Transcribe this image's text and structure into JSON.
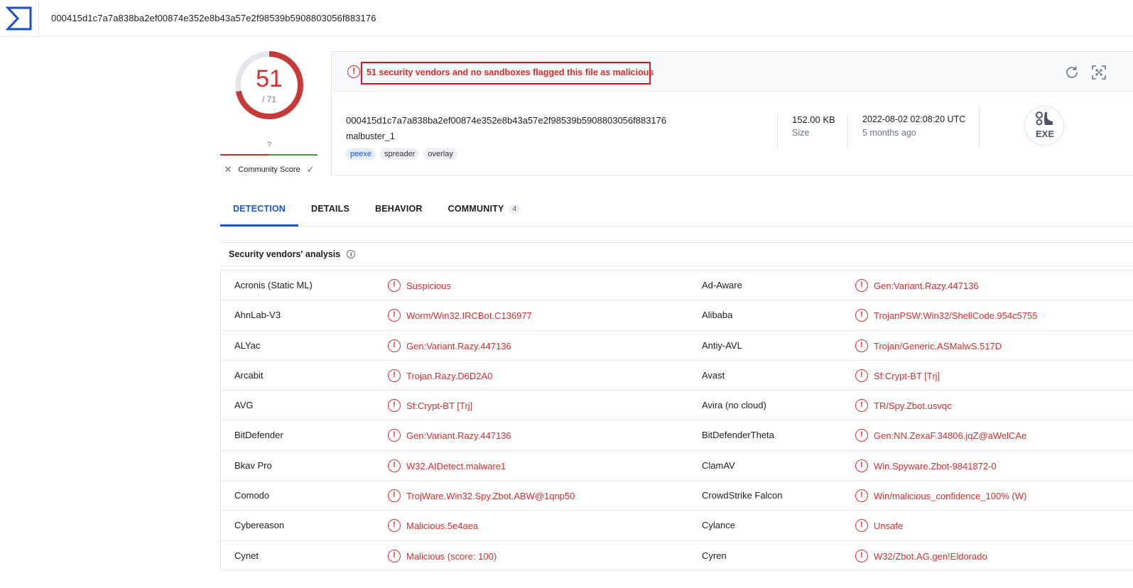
{
  "search": {
    "value": "000415d1c7a7a838ba2ef00874e352e8b43a57e2f98539b5908803056f883176"
  },
  "score": {
    "detections": "51",
    "total": "/ 71",
    "detections_fraction": 0.718
  },
  "community": {
    "score_value": "?",
    "label": "Community Score"
  },
  "alert": {
    "text": "51 security vendors and no sandboxes flagged this file as malicious"
  },
  "file": {
    "hash": "000415d1c7a7a838ba2ef00874e352e8b43a57e2f98539b5908803056f883176",
    "name": "malbuster_1",
    "tags": [
      "peexe",
      "spreader",
      "overlay"
    ],
    "size_value": "152.00 KB",
    "size_label": "Size",
    "date_value": "2022-08-02 02:08:20 UTC",
    "date_label": "5 months ago",
    "type_label": "EXE"
  },
  "tabs": [
    {
      "label": "DETECTION",
      "active": true
    },
    {
      "label": "DETAILS",
      "active": false
    },
    {
      "label": "BEHAVIOR",
      "active": false
    },
    {
      "label": "COMMUNITY",
      "active": false,
      "badge": "4"
    }
  ],
  "section": {
    "title": "Security vendors' analysis"
  },
  "vendors": [
    {
      "left_name": "Acronis (Static ML)",
      "left_result": "Suspicious",
      "right_name": "Ad-Aware",
      "right_result": "Gen:Variant.Razy.447136"
    },
    {
      "left_name": "AhnLab-V3",
      "left_result": "Worm/Win32.IRCBot.C136977",
      "right_name": "Alibaba",
      "right_result": "TrojanPSW:Win32/ShellCode.954c5755"
    },
    {
      "left_name": "ALYac",
      "left_result": "Gen:Variant.Razy.447136",
      "right_name": "Antiy-AVL",
      "right_result": "Trojan/Generic.ASMalwS.517D"
    },
    {
      "left_name": "Arcabit",
      "left_result": "Trojan.Razy.D6D2A0",
      "right_name": "Avast",
      "right_result": "Sf:Crypt-BT [Trj]"
    },
    {
      "left_name": "AVG",
      "left_result": "Sf:Crypt-BT [Trj]",
      "right_name": "Avira (no cloud)",
      "right_result": "TR/Spy.Zbot.usvqc"
    },
    {
      "left_name": "BitDefender",
      "left_result": "Gen:Variant.Razy.447136",
      "right_name": "BitDefenderTheta",
      "right_result": "Gen:NN.ZexaF.34806.jqZ@aWelCAe"
    },
    {
      "left_name": "Bkav Pro",
      "left_result": "W32.AIDetect.malware1",
      "right_name": "ClamAV",
      "right_result": "Win.Spyware.Zbot-9841872-0"
    },
    {
      "left_name": "Comodo",
      "left_result": "TrojWare.Win32.Spy.Zbot.ABW@1qnp50",
      "right_name": "CrowdStrike Falcon",
      "right_result": "Win/malicious_confidence_100% (W)"
    },
    {
      "left_name": "Cybereason",
      "left_result": "Malicious.5e4aea",
      "right_name": "Cylance",
      "right_result": "Unsafe"
    },
    {
      "left_name": "Cynet",
      "left_result": "Malicious (score: 100)",
      "right_name": "Cyren",
      "right_result": "W32/Zbot.AG.gen!Eldorado"
    }
  ],
  "colors": {
    "malicious": "#d32f2f",
    "accent": "#1a56db",
    "community_bad": "#d32f2f",
    "community_good": "#43a047"
  }
}
